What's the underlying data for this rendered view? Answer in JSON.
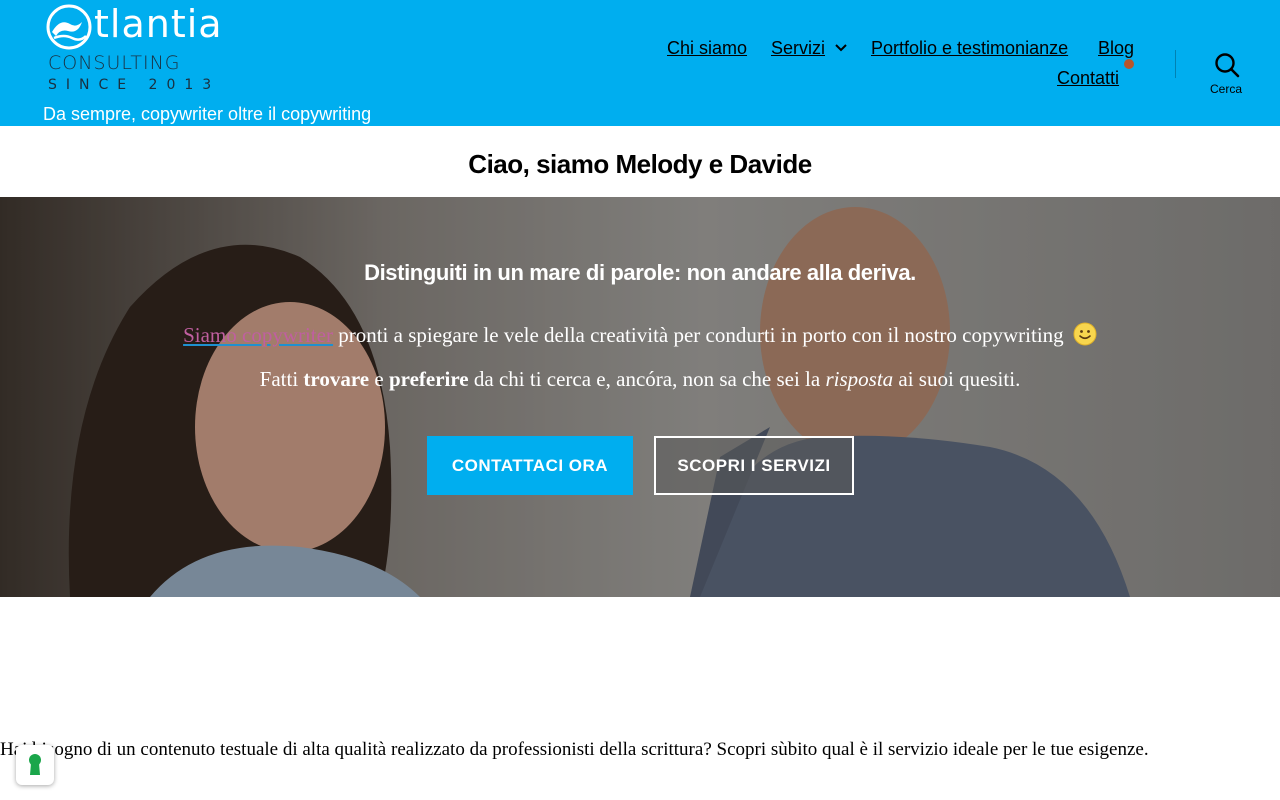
{
  "header": {
    "logo": {
      "word": "tlantia",
      "line2": "CONSULTING",
      "line3": "SINCE 2013"
    },
    "tagline": "Da sempre, copywriter oltre il copywriting",
    "nav": {
      "chi_siamo": "Chi siamo",
      "servizi": "Servizi",
      "portfolio": "Portfolio e testimonianze",
      "blog": "Blog",
      "contatti": "Contatti"
    },
    "search_label": "Cerca",
    "colors": {
      "background": "#00aeef",
      "notification_dot": "#b8552b"
    }
  },
  "page": {
    "title": "Ciao, siamo Melody e Davide"
  },
  "hero": {
    "heading": "Distinguiti in un mare di parole: non andare alla deriva.",
    "p1_link": "Siamo copywriter",
    "p1_rest": " pronti a spiegare le vele della creatività per condurti in porto con il nostro copywriting",
    "p2": {
      "t1": "Fatti ",
      "b1": "trovare",
      "t2": " e ",
      "b2": "preferire",
      "t3": " da chi ti cerca e, ancóra, non sa che sei la ",
      "i1": "risposta",
      "t4": " ai suoi quesiti."
    },
    "buttons": {
      "contact": "CONTATTACI ORA",
      "services": "SCOPRI I SERVIZI"
    }
  },
  "body": {
    "intro": "Hai bisogno di un contenuto testuale di alta qualità realizzato da professionisti della scrittura? Scopri sùbito qual è il servizio ideale per le tue esigenze."
  },
  "icons": {
    "logo": "wave-logo-icon",
    "chevron": "chevron-down-icon",
    "search": "search-icon",
    "smile": "smile-emoji-icon",
    "badge": "keyhole-icon"
  }
}
